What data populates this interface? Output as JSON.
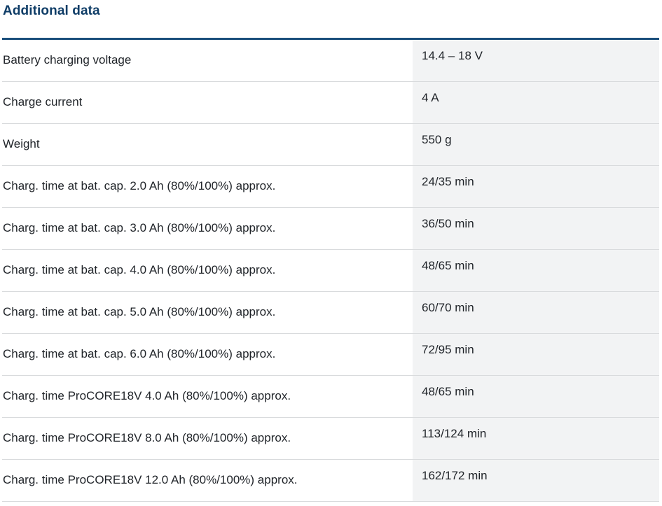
{
  "section": {
    "title": "Additional data"
  },
  "rows": [
    {
      "label": "Battery charging voltage",
      "value": "14.4 – 18 V"
    },
    {
      "label": "Charge current",
      "value": "4 A"
    },
    {
      "label": "Weight",
      "value": "550 g"
    },
    {
      "label": "Charg. time at bat. cap. 2.0 Ah (80%/100%) approx.",
      "value": "24/35 min"
    },
    {
      "label": "Charg. time at bat. cap. 3.0 Ah (80%/100%) approx.",
      "value": "36/50 min"
    },
    {
      "label": "Charg. time at bat. cap. 4.0 Ah (80%/100%) approx.",
      "value": "48/65 min"
    },
    {
      "label": "Charg. time at bat. cap. 5.0 Ah (80%/100%) approx.",
      "value": "60/70 min"
    },
    {
      "label": "Charg. time at bat. cap. 6.0 Ah (80%/100%) approx.",
      "value": "72/95 min"
    },
    {
      "label": "Charg. time ProCORE18V 4.0 Ah (80%/100%) approx.",
      "value": "48/65 min"
    },
    {
      "label": "Charg. time ProCORE18V 8.0 Ah (80%/100%) approx.",
      "value": "113/124 min"
    },
    {
      "label": "Charg. time ProCORE18V 12.0 Ah (80%/100%) approx.",
      "value": "162/172 min"
    }
  ],
  "colors": {
    "title": "#0f3d67",
    "rule": "#1b4f7c",
    "value_bg": "#f2f3f4",
    "row_border": "#d9dbdd",
    "text": "#1f2328"
  }
}
